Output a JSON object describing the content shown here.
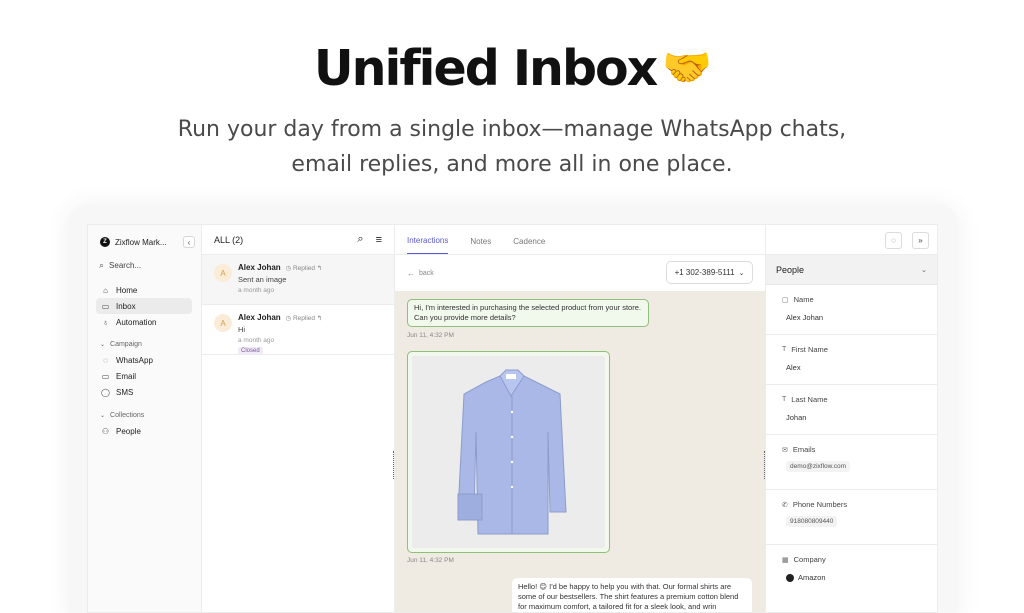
{
  "hero": {
    "title": "Unified Inbox",
    "emoji": "🤝",
    "subtitle": "Run your day from a single inbox—manage WhatsApp chats, email replies, and more all in one place."
  },
  "sidebar": {
    "workspace_logo": "Z",
    "workspace": "Zixflow Mark...",
    "search_label": "Search...",
    "items": [
      {
        "label": "Home",
        "icon": "home-icon"
      },
      {
        "label": "Inbox",
        "icon": "inbox-icon"
      },
      {
        "label": "Automation",
        "icon": "bulb-icon"
      }
    ],
    "campaign_label": "Campaign",
    "campaign_items": [
      {
        "label": "WhatsApp",
        "icon": "whatsapp-icon"
      },
      {
        "label": "Email",
        "icon": "email-icon"
      },
      {
        "label": "SMS",
        "icon": "sms-icon"
      }
    ],
    "collections_label": "Collections",
    "collection_items": [
      {
        "label": "People",
        "icon": "people-icon"
      }
    ]
  },
  "list": {
    "title": "ALL (2)",
    "rows": [
      {
        "avatar": "A",
        "name": "Alex Johan",
        "status": "Replied",
        "message": "Sent an image",
        "time": "a month ago",
        "tag": ""
      },
      {
        "avatar": "A",
        "name": "Alex Johan",
        "status": "Replied",
        "message": "Hi",
        "time": "a month ago",
        "tag": "Closed"
      }
    ]
  },
  "conversation": {
    "tabs": [
      "Interactions",
      "Notes",
      "Cadence"
    ],
    "back_label": "back",
    "phone": "+1 302-389-5111",
    "incoming_message": "Hi, I'm interested in purchasing the selected product from your store. Can you provide more details?",
    "incoming_time": "Jun 11, 4:32 PM",
    "image_time": "Jun 11, 4:32 PM",
    "outgoing_message": "Hello! 😊 I'd be happy to help you with that. Our formal shirts are some of our bestsellers. The shirt features a premium cotton blend for maximum comfort, a tailored fit for a sleek look, and wrin"
  },
  "people": {
    "title": "People",
    "fields": [
      {
        "label": "Name",
        "value": "Alex Johan",
        "icon": "user-icon"
      },
      {
        "label": "First Name",
        "value": "Alex",
        "icon": "text-icon"
      },
      {
        "label": "Last Name",
        "value": "Johan",
        "icon": "text-icon"
      },
      {
        "label": "Emails",
        "value": "demo@zixflow.com",
        "icon": "mail-icon"
      },
      {
        "label": "Phone Numbers",
        "value": "918080809440",
        "icon": "phone-icon"
      },
      {
        "label": "Company",
        "value": "Amazon",
        "icon": "building-icon"
      }
    ]
  },
  "colors": {
    "accent": "#5b59d6",
    "bubble_border": "#8fbf79",
    "chat_bg": "#efeae2"
  }
}
